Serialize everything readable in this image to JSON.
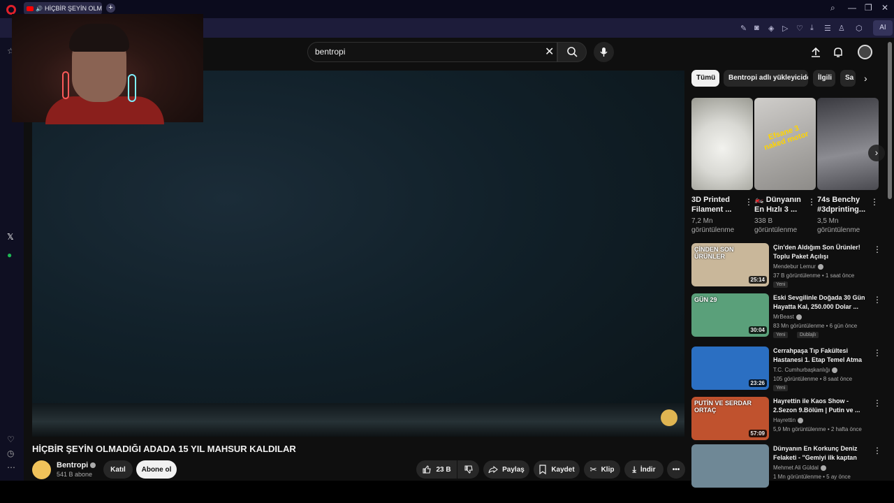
{
  "browser": {
    "tab_title": "HİÇBİR ŞEYİN OLMADI",
    "new_tab_icon": "+",
    "ai_label": "AI"
  },
  "search": {
    "query": "bentropi"
  },
  "video": {
    "title": "HİÇBİR ŞEYİN OLMADIĞI ADADA 15 YIL MAHSUR KALDILAR",
    "channel": "Bentropi",
    "subscribers": "541 B abone",
    "join_label": "Katıl",
    "subscribe_label": "Abone ol",
    "likes": "23 B",
    "share_label": "Paylaş",
    "save_label": "Kaydet",
    "clip_label": "Klip",
    "download_label": "İndir"
  },
  "chips": [
    {
      "label": "Tümü",
      "active": true
    },
    {
      "label": "Bentropi adlı yükleyiciden",
      "active": false
    },
    {
      "label": "İlgili",
      "active": false
    },
    {
      "label": "Sa",
      "active": false
    }
  ],
  "shorts": [
    {
      "title": "3D Printed Filament ...",
      "views": "7,2 Mn görüntülenme",
      "color": "#d9d9d4"
    },
    {
      "title": "🏍️ Dünyanın En Hızlı 3 ...",
      "views": "338 B görüntülenme",
      "color": "#b8b6b4",
      "overlay": "Efsane 3 naked motor"
    },
    {
      "title": "74s Benchy #3dprinting...",
      "views": "3,5 Mn görüntülenme",
      "color": "#6e6e74"
    }
  ],
  "recommendations": [
    {
      "title": "Çin'den Aldığım Son Ürünler! Toplu Paket Açılışı",
      "channel": "Mendebur Lemur",
      "meta": "37 B görüntülenme • 1 saat önce",
      "duration": "25:14",
      "badges": [
        "Yeni"
      ],
      "thumb_color": "#c9b79a",
      "thumb_text": "ÇİNDEN SON ÜRÜNLER"
    },
    {
      "title": "Eski Sevgilinle Doğada 30 Gün Hayatta Kal, 250.000 Dolar ...",
      "channel": "MrBeast",
      "meta": "83 Mn görüntülenme • 6 gün önce",
      "duration": "30:04",
      "badges": [
        "Yeni",
        "Dublajlı"
      ],
      "thumb_color": "#5aa07a",
      "thumb_text": "GÜN 29"
    },
    {
      "title": "Cerrahpaşa Tıp Fakültesi Hastanesi 1. Etap Temel Atma ...",
      "channel": "T.C. Cumhurbaşkanlığı",
      "meta": "105 görüntülenme • 8 saat önce",
      "duration": "23:26",
      "badges": [
        "Yeni"
      ],
      "thumb_color": "#2b6fc2",
      "thumb_text": ""
    },
    {
      "title": "Hayrettin ile Kaos Show - 2.Sezon 9.Bölüm | Putin ve ...",
      "channel": "Hayrettin",
      "meta": "5,9 Mn görüntülenme • 2 hafta önce",
      "duration": "57:09",
      "badges": [],
      "thumb_color": "#c0522e",
      "thumb_text": "PUTİN VE SERDAR ORTAÇ"
    },
    {
      "title": "Dünyanın En Korkunç Deniz Felaketi - \"Gemiyi ilk kaptan te...",
      "channel": "Mehmet Ali Güldal",
      "meta": "1 Mn görüntülenme • 5 ay önce",
      "duration": "",
      "badges": [],
      "thumb_color": "#6f8896",
      "thumb_text": ""
    }
  ]
}
